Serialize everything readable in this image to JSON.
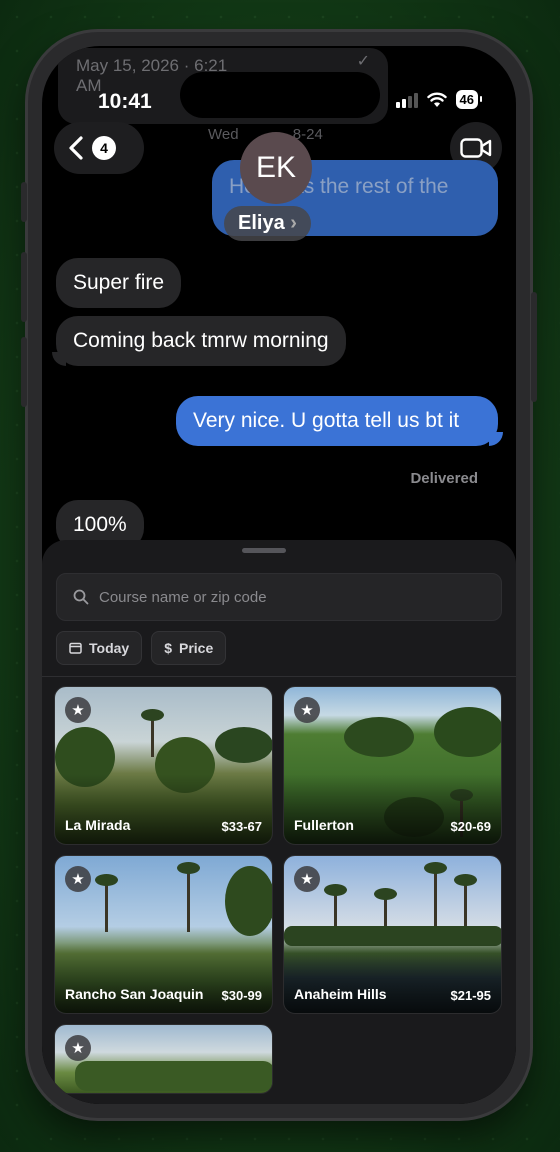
{
  "status_bar": {
    "time": "10:41",
    "battery": "46",
    "ghost_date": "May 15, 2026 · 6:21",
    "ghost_am": "AM",
    "ghost_check": "✓"
  },
  "header": {
    "back_count": "4",
    "ghost_date": "Wed",
    "ghost_date_end": "8-24",
    "avatar_initials": "EK",
    "contact_name": "Eliya"
  },
  "messages": [
    {
      "text": "How was the rest of the",
      "direction": "out"
    },
    {
      "text": "Super fire",
      "direction": "in"
    },
    {
      "text": "Coming back tmrw morning",
      "direction": "in"
    },
    {
      "text": "Very nice. U gotta tell us bt it",
      "direction": "out"
    },
    {
      "text": "100%",
      "direction": "in"
    }
  ],
  "delivered_label": "Delivered",
  "sheet": {
    "search_placeholder": "Course name or zip code",
    "filters": [
      {
        "label": "Today",
        "icon": "calendar-icon"
      },
      {
        "label": "Price",
        "icon": "dollar-icon",
        "symbol": "$"
      }
    ],
    "courses": [
      {
        "name": "La Mirada",
        "price": "$33-67"
      },
      {
        "name": "Fullerton",
        "price": "$20-69"
      },
      {
        "name": "Rancho San Joaquin",
        "price": "$30-99"
      },
      {
        "name": "Anaheim Hills",
        "price": "$21-95"
      },
      {
        "name": "",
        "price": ""
      }
    ]
  },
  "colors": {
    "outgoing_bubble": "#3b73d6",
    "incoming_bubble": "#262628",
    "background_green": "#164219"
  }
}
